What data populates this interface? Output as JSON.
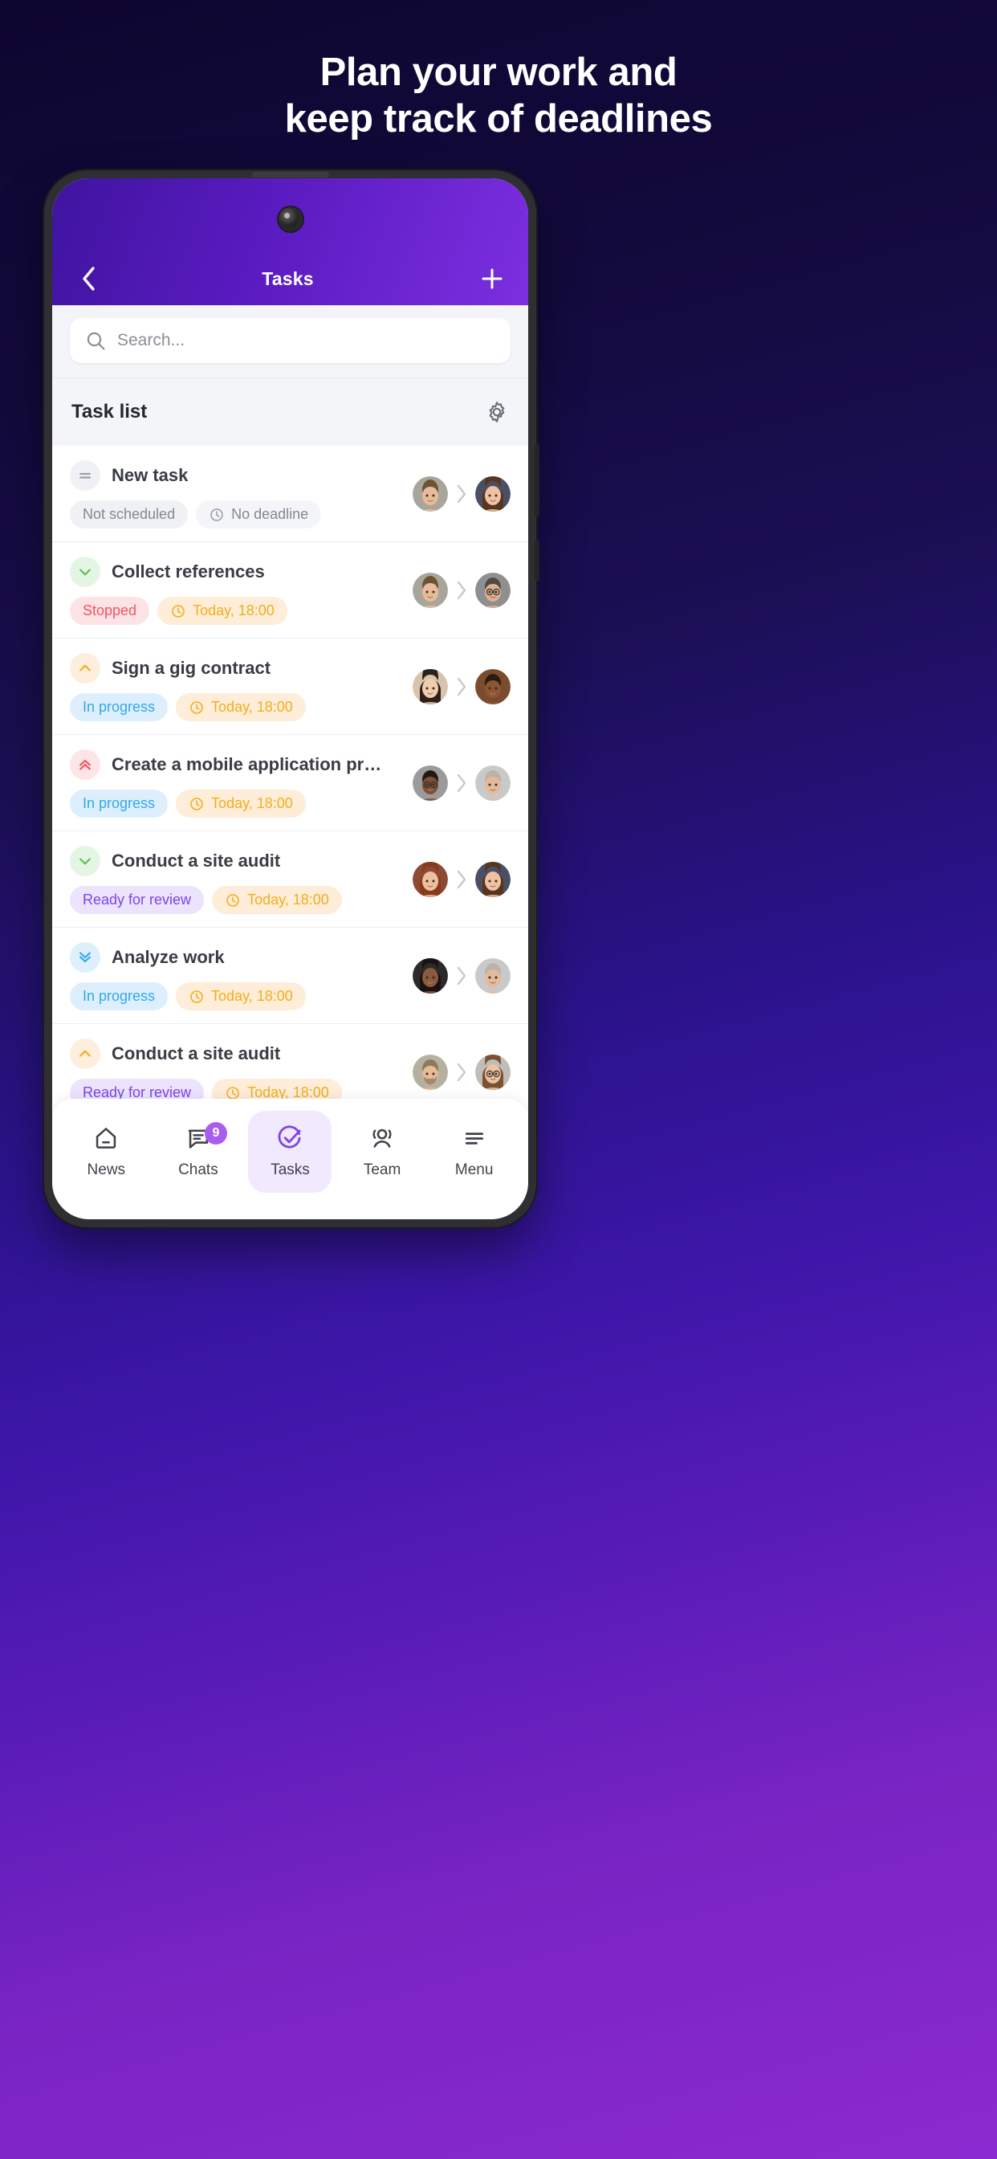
{
  "promo": {
    "headline_line1": "Plan your work and",
    "headline_line2": "keep track of deadlines"
  },
  "appbar": {
    "back_icon": "chevron-left-icon",
    "title": "Tasks",
    "add_icon": "plus-icon"
  },
  "search": {
    "placeholder": "Search...",
    "icon": "search-icon"
  },
  "list_header": {
    "title": "Task list",
    "settings_icon": "gear-icon"
  },
  "tasks": [
    {
      "title": "New task",
      "priority_icon": "equals-icon",
      "priority_tone": "grey",
      "status": "Not scheduled",
      "status_tone": "status-grey",
      "deadline": "No deadline",
      "deadline_tone": "time-grey",
      "clock_icon": "clock-icon",
      "avatar_from": "avatar-man-1",
      "avatar_to": "avatar-woman-1",
      "arrow_icon": "chevron-right-icon"
    },
    {
      "title": "Collect references",
      "priority_icon": "chevron-down-icon",
      "priority_tone": "green",
      "status": "Stopped",
      "status_tone": "status-red",
      "deadline": "Today, 18:00",
      "deadline_tone": "time-amber",
      "clock_icon": "clock-icon",
      "avatar_from": "avatar-man-1",
      "avatar_to": "avatar-man-glasses",
      "arrow_icon": "chevron-right-icon"
    },
    {
      "title": "Sign a gig contract",
      "priority_icon": "chevron-up-icon",
      "priority_tone": "orange",
      "status": "In progress",
      "status_tone": "status-blue",
      "deadline": "Today, 18:00",
      "deadline_tone": "time-amber",
      "clock_icon": "clock-icon",
      "avatar_from": "avatar-woman-asian",
      "avatar_to": "avatar-man-dark",
      "arrow_icon": "chevron-right-icon"
    },
    {
      "title": "Create a mobile application pro...",
      "priority_icon": "chevrons-up-icon",
      "priority_tone": "red",
      "status": "In progress",
      "status_tone": "status-blue",
      "deadline": "Today, 18:00",
      "deadline_tone": "time-amber",
      "clock_icon": "clock-icon",
      "avatar_from": "avatar-man-dark-2",
      "avatar_to": "avatar-man-grey",
      "arrow_icon": "chevron-right-icon"
    },
    {
      "title": "Conduct a site audit",
      "priority_icon": "chevron-down-icon",
      "priority_tone": "green",
      "status": "Ready for review",
      "status_tone": "status-purple",
      "deadline": "Today, 18:00",
      "deadline_tone": "time-amber",
      "clock_icon": "clock-icon",
      "avatar_from": "avatar-woman-red",
      "avatar_to": "avatar-woman-1",
      "arrow_icon": "chevron-right-icon"
    },
    {
      "title": "Analyze work",
      "priority_icon": "chevrons-down-icon",
      "priority_tone": "blue",
      "status": "In progress",
      "status_tone": "status-blue",
      "deadline": "Today, 18:00",
      "deadline_tone": "time-amber",
      "clock_icon": "clock-icon",
      "avatar_from": "avatar-woman-dark",
      "avatar_to": "avatar-man-grey",
      "arrow_icon": "chevron-right-icon"
    },
    {
      "title": "Conduct a site audit",
      "priority_icon": "chevron-up-icon",
      "priority_tone": "orange",
      "status": "Ready for review",
      "status_tone": "status-purple",
      "deadline": "Today, 18:00",
      "deadline_tone": "time-amber",
      "clock_icon": "clock-icon",
      "avatar_from": "avatar-man-beard",
      "avatar_to": "avatar-woman-glasses",
      "arrow_icon": "chevron-right-icon"
    }
  ],
  "tabbar": [
    {
      "label": "News",
      "icon": "home-icon",
      "active": false,
      "badge": ""
    },
    {
      "label": "Chats",
      "icon": "chat-bubble-icon",
      "active": false,
      "badge": "9"
    },
    {
      "label": "Tasks",
      "icon": "check-circle-icon",
      "active": true,
      "badge": ""
    },
    {
      "label": "Team",
      "icon": "people-icon",
      "active": false,
      "badge": ""
    },
    {
      "label": "Menu",
      "icon": "hamburger-icon",
      "active": false,
      "badge": ""
    }
  ],
  "colors": {
    "brand_purple": "#7c2fe0",
    "accent_violet": "#a95cf0",
    "status_red": "#f2545f",
    "status_blue": "#30a8ef",
    "status_purple": "#7d43e8",
    "amber": "#f5ad1b",
    "green": "#5cc24a"
  }
}
